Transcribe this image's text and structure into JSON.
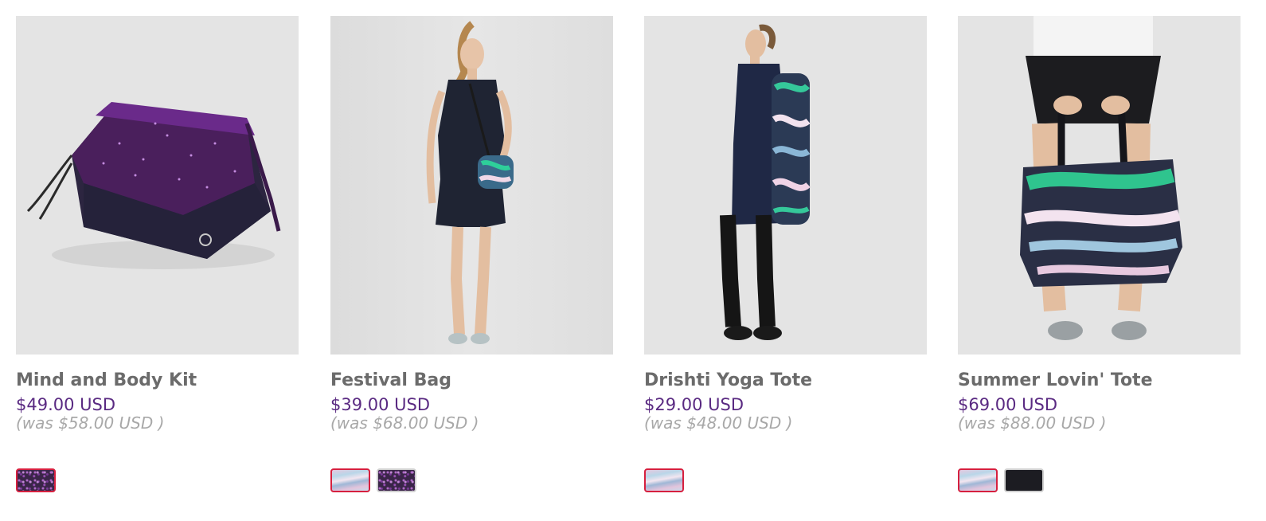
{
  "products": [
    {
      "name": "Mind and Body Kit",
      "price": "$49.00 USD",
      "was_price": "(was $58.00 USD )",
      "image_icon": "purple-sparkle-pouch-image",
      "swatches": [
        {
          "style": "sparkle-purple",
          "selected": true
        }
      ]
    },
    {
      "name": "Festival Bag",
      "price": "$39.00 USD",
      "was_price": "(was $68.00 USD )",
      "image_icon": "model-with-crossbody-bag-image",
      "swatches": [
        {
          "style": "print-multi",
          "selected": true
        },
        {
          "style": "sparkle-purple",
          "selected": false
        }
      ]
    },
    {
      "name": "Drishti Yoga Tote",
      "price": "$29.00 USD",
      "was_price": "(was $48.00 USD )",
      "image_icon": "model-with-yoga-tote-image",
      "swatches": [
        {
          "style": "print-multi",
          "selected": true
        }
      ]
    },
    {
      "name": "Summer Lovin' Tote",
      "price": "$69.00 USD",
      "was_price": "(was $88.00 USD )",
      "image_icon": "model-holding-tote-image",
      "swatches": [
        {
          "style": "print-multi",
          "selected": true
        },
        {
          "style": "solid-black",
          "selected": false
        }
      ]
    }
  ],
  "colors": {
    "price": "#5a2a82",
    "name": "#6b6b6b",
    "was_price": "#a8a8a8",
    "selected_swatch_border": "#d6203f"
  }
}
